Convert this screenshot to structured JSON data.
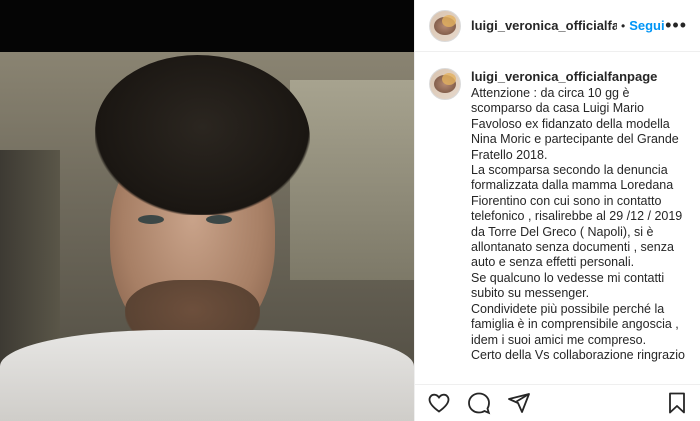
{
  "post": {
    "username": "luigi_veronica_officialfanpa",
    "separator": "•",
    "follow_label": "Segui",
    "more_label": "•••"
  },
  "caption": {
    "username": "luigi_veronica_officialfanpage",
    "lines": [
      "Attenzione : da circa 10 gg è",
      "scomparso da casa Luigi Mario",
      "Favoloso ex fidanzato della modella",
      "Nina Moric e partecipante del Grande",
      "Fratello 2018.",
      "La scomparsa secondo la denuncia",
      "formalizzata dalla mamma Loredana",
      "Fiorentino con cui sono in contatto",
      "telefonico , risalirebbe al 29 /12 / 2019",
      "da Torre Del Greco ( Napoli), si è",
      "allontanato senza documenti , senza",
      "auto e senza effetti personali.",
      "Se qualcuno lo vedesse mi contatti",
      "subito su messenger.",
      "Condividete più possibile perché la",
      "famiglia è in comprensibile angoscia ,",
      "idem i suoi amici me compreso.",
      "Certo della Vs collaborazione ringrazio"
    ]
  },
  "icons": {
    "like": "heart-icon",
    "comment": "comment-icon",
    "share": "share-icon",
    "save": "bookmark-icon"
  },
  "colors": {
    "follow": "#0095f6",
    "text": "#262626",
    "border": "#efefef"
  }
}
